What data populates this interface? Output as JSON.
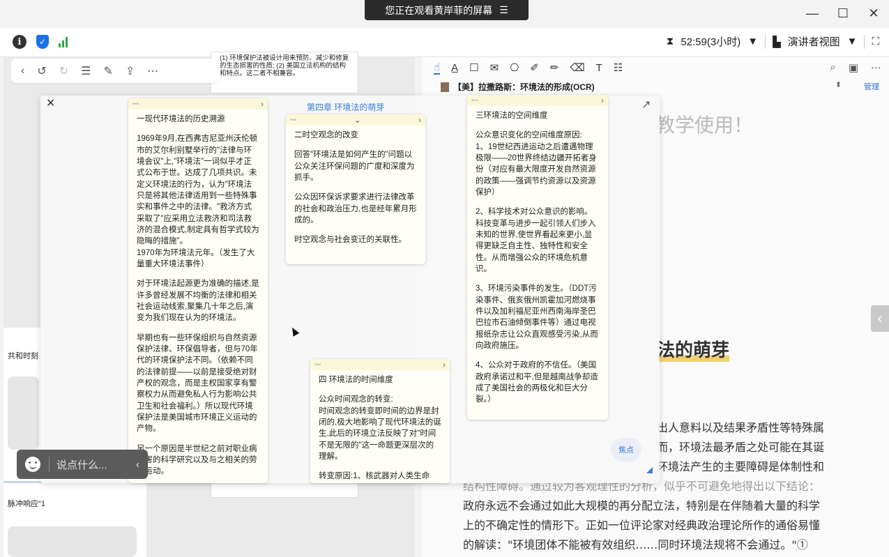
{
  "banner": {
    "text": "您正在观看黄岸菲的屏幕",
    "menu_icon": "menu-icon"
  },
  "window": {
    "min": "—",
    "max": "☐",
    "close": "✕"
  },
  "meeting": {
    "timer": "52:59(3小时)",
    "view": "演讲者视图",
    "status_colors": {
      "shield": "#1a73e8",
      "signal": "#2aa845"
    }
  },
  "left_doc": {
    "back_note_text": "(1) 环境保护法被设计用来预防、减少和修复的生态损害的性质; (2) 美国立法机构的结构和特点。这二者不相兼容。",
    "strip_title_1": "共和时刻",
    "strip_title_2": "脉冲响应\"1"
  },
  "pdf": {
    "doc_title": "【美】拉撒路斯：环境法的形成(OCR)",
    "manage": "管理",
    "watermark": "教学使用！",
    "heading": "法的萌芽",
    "lines": [
      "出人意料以及结果矛盾性等特殊属",
      "而，环境法最矛盾之处可能在其诞",
      "环境法产生的主要障碍是体制性和",
      "结构性障碍。通过较为客观理性的分析，似乎不可避免地得出以下结论：",
      "政府永远不会通过如此大规模的再分配立法，特别是在伴随着大量的科学",
      "上的不确定性的情形下。正如一位评论家对经典政治理论所作的通俗易懂",
      "的解读：\"环境团体不能被有效组织……同时环境法规将不会通过。\"①"
    ]
  },
  "mindmap": {
    "title": "第四章  环境法的萌芽",
    "focus": "焦点",
    "note1": {
      "title": "一现代环境法的历史溯源",
      "p1": "1969年9月,在西弗吉尼亚州沃伦顿市的艾尔利别墅举行的\"法律与环境会议\"上,\"环境法\"一词似乎才正式公布于世。达成了几项共识。未定义环境法的行为，认为\"环境法只是将其他法律适用到一些特殊事实和事件之中的法律。\"救济方式采取了\"应采用立法救济和司法救济的混合模式,制定具有哲学式较为隐晦的措施\"。",
      "p1b": "1970年为环境法元年。（发生了大量重大环境法事件）",
      "p2": "对于环境法起源更为准确的描述,是许多曾经发展不均衡的法律和相关社会运动线索,聚集几十年之后,演变为我们现在认为的环境法。",
      "p3": "早期也有一些环保组织与自然资源保护法律、环保倡导者，但与70年代的环境保护法不同。（依赖不同的法律前提——以前是接受绝对财产权的观念，而是主权国家享有警察权力从而避免私人行为影响公共卫生和社会福利。）所以现代环境保护法是美国城市环境正义运动的产物。",
      "p4": "另一个原因是半世纪之前对职业病危害的科学研究以及与之相关的劳工运动。"
    },
    "note2": {
      "title": "二时空观念的改变",
      "p1": "回答\"环境法是如何产生的\"问题以公众关注环保问题的广度和深度为抓手。",
      "p2": "公众因环保诉求要求进行法律改革的社会和政治压力,也是经年累月形成的。",
      "p3": "时空观念与社会变迁的关联性。"
    },
    "note3": {
      "title": "三环境法的空间维度",
      "p1": "公众意识变化的空间维度原因:\n1、19世纪西进运动之后遭遇物理极限——20世界终结边疆开拓者身份（对应有最大限度开发自然资源的政策——强调节约资源以及资源保护）",
      "p2": "2、科学技术对公众意识的影响。科技变革与进步一起引领人们步入未知的世界,使世界看起来更小,显得更缺乏自主性、独特性和安全性。从而增强公众的环境危机意识。",
      "p3": "3、环境污染事件的发生。（DDT污染事件、俄亥俄州凯霍加河燃烧事件以及加利福尼亚州西南海岸圣巴巴拉市石油倾倒事件等）通过电视报纸杂志让公众直观感受污染,从而向政府施压。",
      "p4": "4、公众对于政府的不信任。（美国政府承诺过和平,但是越南战争却造成了美国社会的两极化和巨大分裂。）"
    },
    "note4": {
      "title": "四 环境法的时间维度",
      "p1": "公众时间观念的转变:\n时间观念的转变即时间的边界是封闭的,极大地影响了现代环境法的诞生,此后的环境立法反映了对\"时间不是无限的\"这一命题更深层次的理解。",
      "p2": "转变原因:1、核武器对人类生命"
    }
  },
  "chat": {
    "placeholder": "说点什么..."
  }
}
